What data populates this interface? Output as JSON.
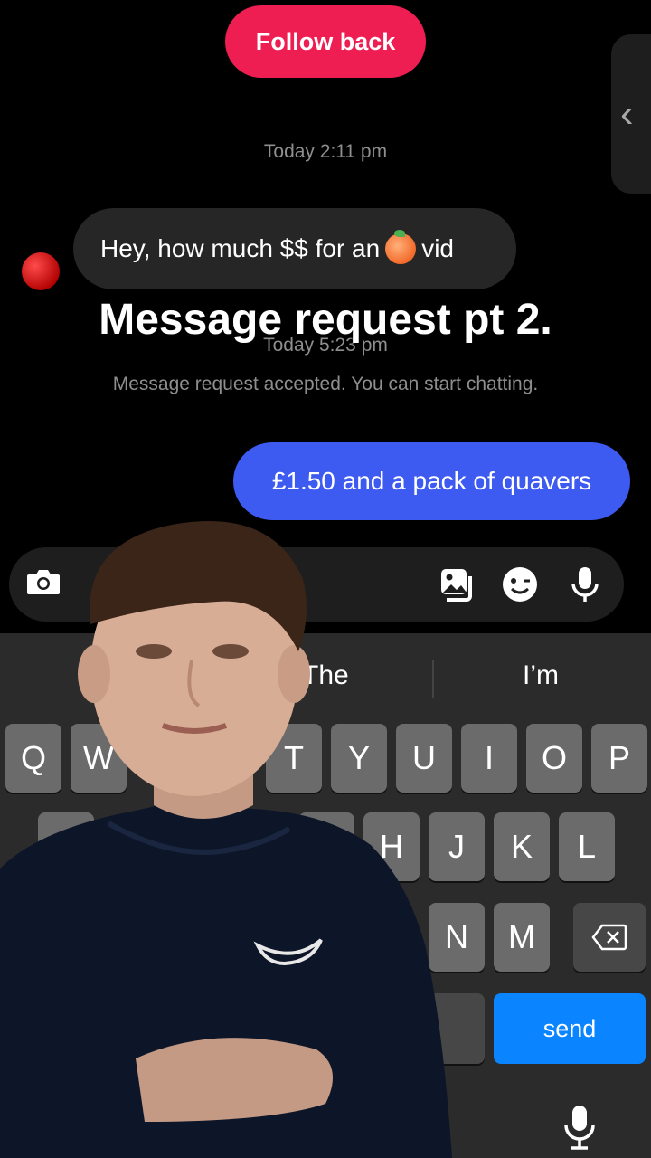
{
  "header": {
    "follow_back_label": "Follow back"
  },
  "side_tab": {
    "chevron": "‹"
  },
  "conversation": {
    "timestamp_1": "Today 2:11 pm",
    "incoming_message_before": "Hey, how much $$ for an",
    "incoming_message_emoji": "peach-emoji",
    "incoming_message_after": "vid",
    "timestamp_2": "Today 5:23 pm",
    "system_note": "Message request accepted. You can start chatting.",
    "outgoing_message": "£1.50 and a pack of quavers"
  },
  "overlay": {
    "title": "Message request pt 2."
  },
  "composer": {
    "icons": [
      "camera-icon",
      "gallery-icon",
      "sticker-icon",
      "microphone-icon"
    ]
  },
  "keyboard": {
    "suggestions": [
      "The",
      "I’m"
    ],
    "row1": [
      "Q",
      "W",
      "T",
      "Y",
      "U",
      "I",
      "O",
      "P"
    ],
    "row2": [
      "A",
      "G",
      "H",
      "J",
      "K",
      "L"
    ],
    "row3": [
      "N",
      "M"
    ],
    "send_label": "send"
  },
  "colors": {
    "follow_button": "#ee1d52",
    "outgoing_bubble": "#3d5af1",
    "send_key": "#0a84ff",
    "incoming_bubble": "#262626"
  }
}
